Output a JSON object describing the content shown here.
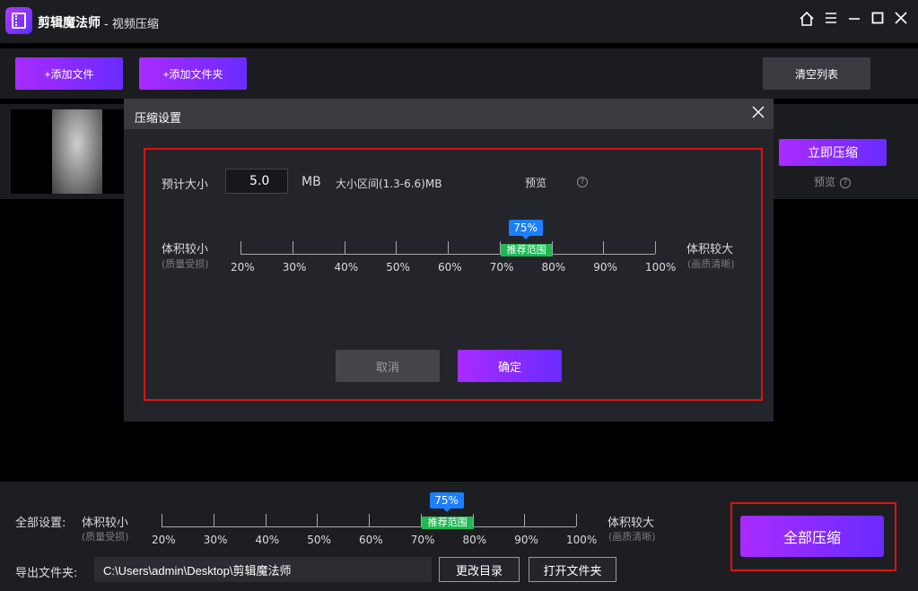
{
  "titlebar": {
    "app_name": "剪辑魔法师",
    "subtitle": "- 视频压缩",
    "icons": [
      "home-icon",
      "menu-icon",
      "minimize-icon",
      "maximize-icon",
      "close-icon"
    ]
  },
  "toolbar": {
    "add_file_label": "+添加文件",
    "add_folder_label": "+添加文件夹",
    "clear_list_label": "清空列表"
  },
  "file_row": {
    "compress_now_label": "立即压缩",
    "preview_label": "预览",
    "help_glyph": "?"
  },
  "dialog": {
    "title": "压缩设置",
    "estimated_size_label": "预计大小",
    "size_value": "5.0",
    "size_unit": "MB",
    "size_range": "大小区间(1.3-6.6)MB",
    "preview_label": "预览",
    "help_glyph": "?",
    "slider_left_label": "体积较小",
    "slider_left_sub": "(质量受损)",
    "slider_right_label": "体积较大",
    "slider_right_sub": "(画质清晰)",
    "slider_ticks": [
      "20%",
      "30%",
      "40%",
      "50%",
      "60%",
      "70%",
      "80%",
      "90%",
      "100%"
    ],
    "slider_value_label": "75%",
    "slider_value": 75,
    "recommended_label": "推荐范围",
    "cancel_label": "取消",
    "confirm_label": "确定"
  },
  "bottom": {
    "global_settings_label": "全部设置:",
    "slider_left_label": "体积较小",
    "slider_left_sub": "(质量受损)",
    "slider_right_label": "体积较大",
    "slider_right_sub": "(画质清晰)",
    "slider_ticks": [
      "20%",
      "30%",
      "40%",
      "50%",
      "60%",
      "70%",
      "80%",
      "90%",
      "100%"
    ],
    "slider_value_label": "75%",
    "slider_value": 75,
    "recommended_label": "推荐范围",
    "export_folder_label": "导出文件夹:",
    "export_path": "C:\\Users\\admin\\Desktop\\剪辑魔法师",
    "change_dir_label": "更改目录",
    "open_folder_label": "打开文件夹",
    "compress_all_label": "全部压缩"
  },
  "colors": {
    "accent_purple": "#a92bff",
    "accent_blue": "#1b7fff",
    "recommended_green": "#1fb954",
    "highlight_red": "#e01010"
  }
}
